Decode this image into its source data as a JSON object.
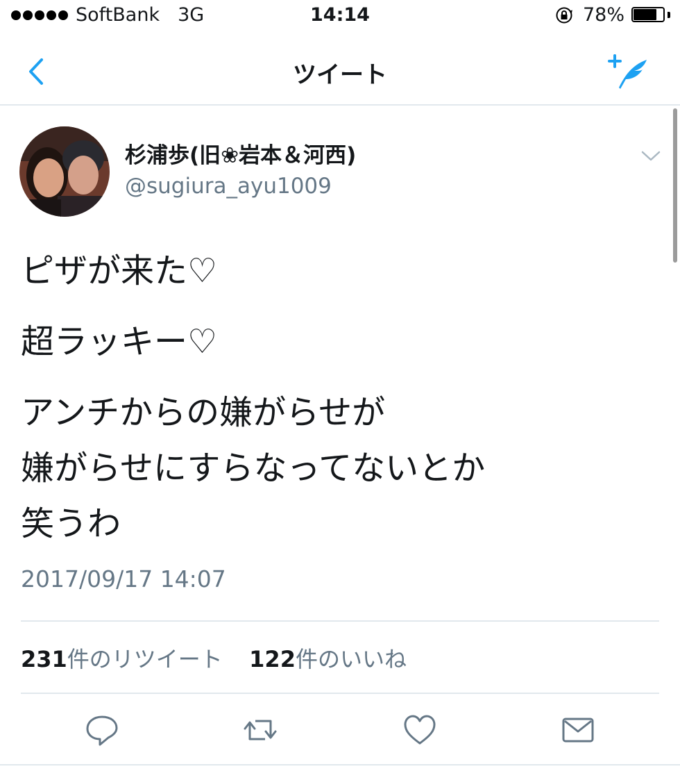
{
  "status_bar": {
    "carrier": "SoftBank",
    "network": "3G",
    "time": "14:14",
    "battery_text": "78%",
    "battery_level": 0.78
  },
  "nav": {
    "title": "ツイート"
  },
  "tweet": {
    "display_name": "杉浦歩(旧❀岩本＆河西)",
    "username": "@sugiura_ayu1009",
    "lines": [
      "ピザが来た♡",
      "超ラッキー♡",
      "アンチからの嫌がらせが",
      "嫌がらせにすらなってないとか",
      "笑うわ"
    ],
    "timestamp": "2017/09/17 14:07",
    "retweet_count": "231",
    "retweet_label": "件のリツイート",
    "like_count": "122",
    "like_label": "件のいいね"
  },
  "colors": {
    "accent": "#1da1f2",
    "secondary_text": "#657786",
    "divider": "#e1e8ed",
    "icon_gray": "#657786"
  },
  "icons": {
    "back": "chevron-left-icon",
    "compose": "compose-quill-icon",
    "caret": "chevron-down-icon",
    "reply": "reply-icon",
    "retweet": "retweet-icon",
    "like": "heart-icon",
    "message": "envelope-icon"
  }
}
